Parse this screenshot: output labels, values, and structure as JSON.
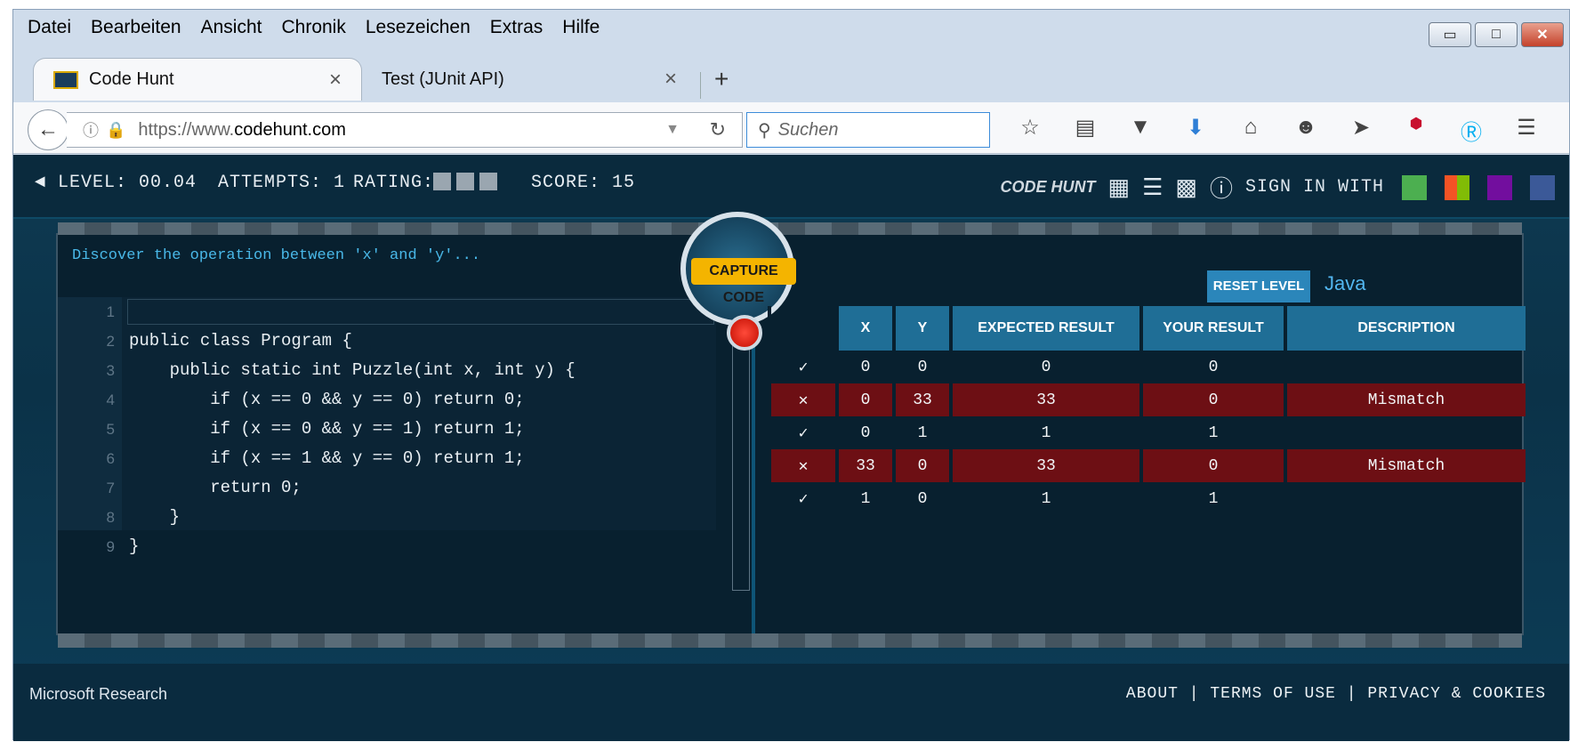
{
  "menu": [
    "Datei",
    "Bearbeiten",
    "Ansicht",
    "Chronik",
    "Lesezeichen",
    "Extras",
    "Hilfe"
  ],
  "window_buttons": {
    "minimize": "▭",
    "maximize": "□",
    "close": "✕"
  },
  "tabs": [
    {
      "label": "Code Hunt",
      "close": "×"
    },
    {
      "label": "Test (JUnit API)",
      "close": "×"
    }
  ],
  "new_tab": "+",
  "url": {
    "prefix": "https://www.",
    "domain": "codehunt.com"
  },
  "search_placeholder": "Suchen",
  "hud": {
    "level_label": "◄ LEVEL: 00.04",
    "attempts_label": "ATTEMPTS: 1",
    "rating_label": "RATING:",
    "score_label": "SCORE: 15",
    "sign_in": "SIGN IN WITH",
    "logo": "CODE HUNT"
  },
  "puzzle_description": "Discover the operation between 'x' and 'y'...",
  "capture_label": "CAPTURE CODE",
  "reset_label": "RESET LEVEL",
  "language": "Java",
  "code_lines": [
    {
      "n": "1",
      "text": ""
    },
    {
      "n": "2",
      "text": "public class Program {"
    },
    {
      "n": "3",
      "text": "    public static int Puzzle(int x, int y) {"
    },
    {
      "n": "4",
      "text": "        if (x == 0 && y == 0) return 0;"
    },
    {
      "n": "5",
      "text": "        if (x == 0 && y == 1) return 1;"
    },
    {
      "n": "6",
      "text": "        if (x == 1 && y == 0) return 1;"
    },
    {
      "n": "7",
      "text": "        return 0;"
    },
    {
      "n": "8",
      "text": "    }"
    },
    {
      "n": "9",
      "text": "}"
    }
  ],
  "results": {
    "headers": [
      "X",
      "Y",
      "EXPECTED RESULT",
      "YOUR RESULT",
      "DESCRIPTION"
    ],
    "rows": [
      {
        "status": "✓",
        "x": "0",
        "y": "0",
        "expected": "0",
        "yours": "0",
        "description": ""
      },
      {
        "status": "✕",
        "x": "0",
        "y": "33",
        "expected": "33",
        "yours": "0",
        "description": "Mismatch"
      },
      {
        "status": "✓",
        "x": "0",
        "y": "1",
        "expected": "1",
        "yours": "1",
        "description": ""
      },
      {
        "status": "✕",
        "x": "33",
        "y": "0",
        "expected": "33",
        "yours": "0",
        "description": "Mismatch"
      },
      {
        "status": "✓",
        "x": "1",
        "y": "0",
        "expected": "1",
        "yours": "1",
        "description": ""
      }
    ]
  },
  "footer": {
    "brand": "Microsoft Research",
    "links": "ABOUT | TERMS OF USE | PRIVACY & COOKIES"
  },
  "colors": {
    "accent": "#2b86ba",
    "mismatch": "#6d0f14",
    "check": "#f2c400",
    "cross": "#ff3040"
  }
}
